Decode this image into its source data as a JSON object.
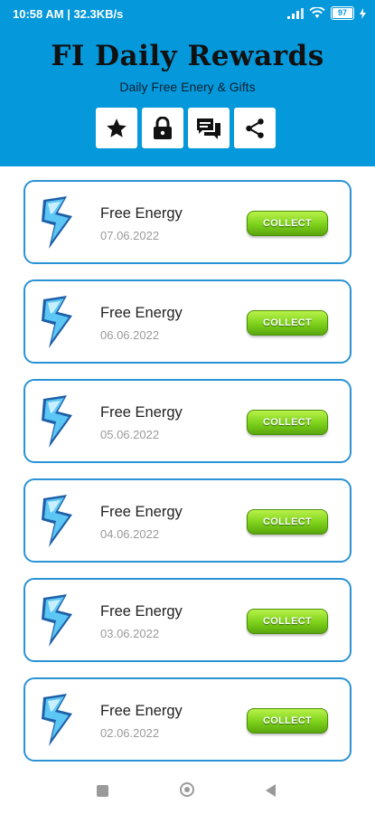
{
  "status_bar": {
    "time_and_speed": "10:58 AM | 32.3KB/s",
    "battery": "97"
  },
  "header": {
    "title": "FI Daily Rewards",
    "subtitle": "Daily Free Enery & Gifts",
    "toolbar_icons": [
      "star-icon",
      "lock-icon",
      "chat-icon",
      "share-icon"
    ]
  },
  "rewards": [
    {
      "title": "Free Energy",
      "date": "07.06.2022",
      "button": "COLLECT"
    },
    {
      "title": "Free Energy",
      "date": "06.06.2022",
      "button": "COLLECT"
    },
    {
      "title": "Free Energy",
      "date": "05.06.2022",
      "button": "COLLECT"
    },
    {
      "title": "Free Energy",
      "date": "04.06.2022",
      "button": "COLLECT"
    },
    {
      "title": "Free Energy",
      "date": "03.06.2022",
      "button": "COLLECT"
    },
    {
      "title": "Free Energy",
      "date": "02.06.2022",
      "button": "COLLECT"
    }
  ],
  "nav_bar": {
    "icons": [
      "recents-icon",
      "home-icon",
      "back-icon"
    ]
  },
  "colors": {
    "header_blue": "#0598db",
    "card_border": "#2a93d5",
    "collect_green": "#7cd11a"
  }
}
